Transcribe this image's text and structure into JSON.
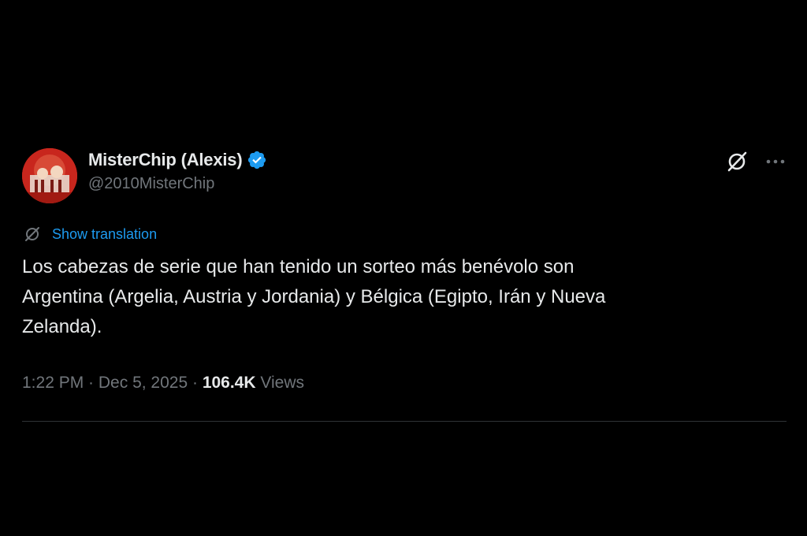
{
  "author": {
    "display_name": "MisterChip (Alexis)",
    "handle": "@2010MisterChip",
    "verified": true,
    "verified_color": "#1d9bf0",
    "avatar_color": "#c8261d"
  },
  "actions": {
    "grok_icon": "grok-icon",
    "more_icon": "more-icon"
  },
  "translation": {
    "icon": "translate-icon",
    "label": "Show translation"
  },
  "tweet": {
    "text_line1": "Los cabezas de serie que han tenido un sorteo más benévolo son",
    "text_line2": "Argentina (Argelia, Austria y Jordania) y Bélgica (Egipto, Irán y Nueva",
    "text_line3": "Zelanda)."
  },
  "meta": {
    "time": "1:22 PM",
    "sep1": " · ",
    "date": "Dec 5, 2025",
    "sep2": " · ",
    "views_count": "106.4K",
    "views_label": " Views"
  },
  "colors": {
    "background": "#000000",
    "text": "#e7e9ea",
    "secondary": "#71767b",
    "link": "#1d9bf0",
    "divider": "#2f3336"
  }
}
